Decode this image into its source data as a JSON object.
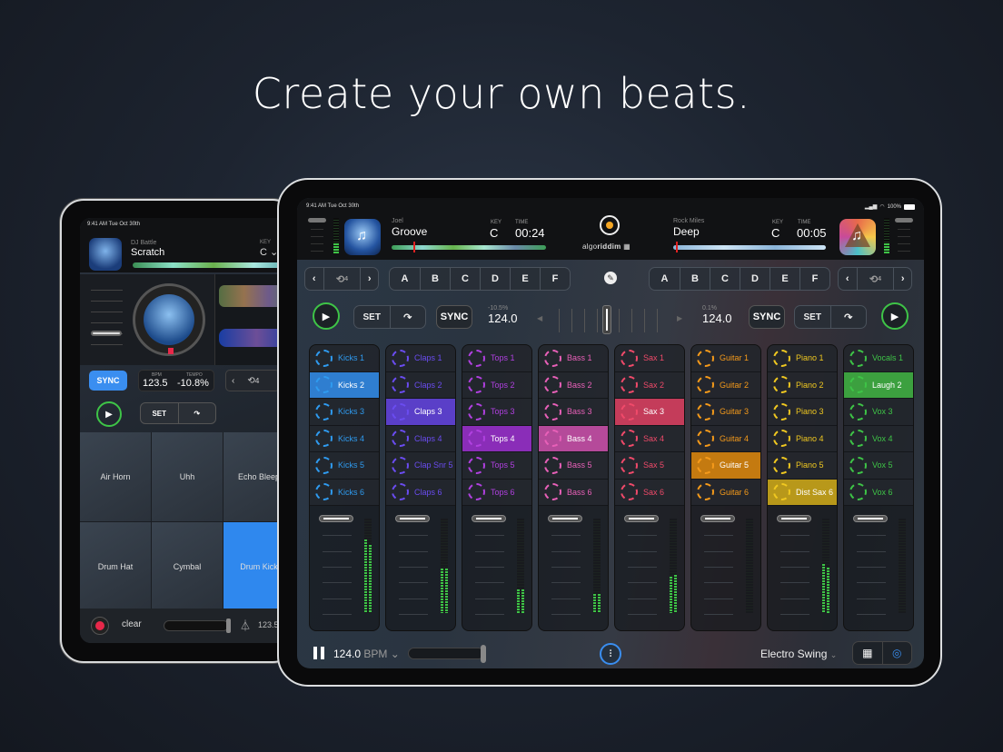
{
  "headline": "Create your own beats.",
  "small_ipad": {
    "status_time": "9:41 AM  Tue Oct 30th",
    "deck": {
      "artist": "DJ Battle",
      "title": "Scratch",
      "key_label": "KEY",
      "key": "C ⌄"
    },
    "sync_label": "SYNC",
    "bpm_label": "BPM",
    "bpm": "123.5",
    "tempo_label": "TEMPO",
    "tempo": "-10.8%",
    "loop_count": "4",
    "set_label": "SET",
    "pads": [
      {
        "label": "Air Horn",
        "active": false
      },
      {
        "label": "Uhh",
        "active": false
      },
      {
        "label": "Echo Bleep",
        "active": false
      },
      {
        "label": "Drum Hat",
        "active": false
      },
      {
        "label": "Cymbal",
        "active": false
      },
      {
        "label": "Drum Kick",
        "active": true
      }
    ],
    "clear_label": "clear",
    "footer_bpm": "123.5"
  },
  "large_ipad": {
    "status_time": "9:41 AM  Tue Oct 30th",
    "status_battery": "100%",
    "brand": {
      "prefix": "algo",
      "suffix": "riddim"
    },
    "deck_left": {
      "artist": "Joel",
      "title": "Groove",
      "key_label": "KEY",
      "key": "C",
      "time_label": "TIME",
      "time": "00:24",
      "pitch": "-10.5%",
      "bpm": "124.0",
      "loop_count": "4"
    },
    "deck_right": {
      "artist": "Rock Miles",
      "title": "Deep",
      "key_label": "KEY",
      "key": "C",
      "time_label": "TIME",
      "time": "00:05",
      "pitch": "0.1%",
      "bpm": "124.0",
      "loop_count": "4"
    },
    "cue_points": [
      "A",
      "B",
      "C",
      "D",
      "E",
      "F"
    ],
    "set_label": "SET",
    "sync_label": "SYNC",
    "crossfader_position": 0.5,
    "columns": [
      {
        "color": "#2f9bf0",
        "active_bg": "#2f7ed0",
        "pads": [
          "Kicks 1",
          "Kicks 2",
          "Kicks 3",
          "Kicks 4",
          "Kicks 5",
          "Kicks 6"
        ],
        "active": 1,
        "level": [
          0.78,
          0.72
        ]
      },
      {
        "color": "#6a4cf0",
        "active_bg": "#5a3fc8",
        "pads": [
          "Claps 1",
          "Claps 2",
          "Claps 3",
          "Claps 4",
          "Clap Snr 5",
          "Claps 6"
        ],
        "active": 2,
        "level": [
          0.47,
          0.47
        ]
      },
      {
        "color": "#b040e0",
        "active_bg": "#8a2db8",
        "pads": [
          "Tops 1",
          "Tops 2",
          "Tops 3",
          "Tops 4",
          "Tops 5",
          "Tops 6"
        ],
        "active": 3,
        "level": [
          0.25,
          0.25
        ]
      },
      {
        "color": "#e860b8",
        "active_bg": "#b54a9a",
        "pads": [
          "Bass 1",
          "Bass 2",
          "Bass 3",
          "Bass 4",
          "Bass 5",
          "Bass 6"
        ],
        "active": 3,
        "level": [
          0.2,
          0.2
        ]
      },
      {
        "color": "#f04a6a",
        "active_bg": "#c43c5a",
        "pads": [
          "Sax 1",
          "Sax 2",
          "Sax 3",
          "Sax 4",
          "Sax 5",
          "Sax 6"
        ],
        "active": 2,
        "level": [
          0.38,
          0.4
        ]
      },
      {
        "color": "#f59a1a",
        "active_bg": "#c47a10",
        "pads": [
          "Guitar 1",
          "Guitar 2",
          "Guitar 3",
          "Guitar 4",
          "Guitar 5",
          "Guitar 6"
        ],
        "active": 4,
        "level": [
          0,
          0
        ]
      },
      {
        "color": "#f0c820",
        "active_bg": "#b8981a",
        "pads": [
          "Piano 1",
          "Piano 2",
          "Piano 3",
          "Piano 4",
          "Piano 5",
          "Dist Sax 6"
        ],
        "active": 5,
        "level": [
          0.52,
          0.48
        ]
      },
      {
        "color": "#3ec447",
        "active_bg": "#3ca03f",
        "pads": [
          "Vocals 1",
          "Laugh 2",
          "Vox 3",
          "Vox 4",
          "Vox 5",
          "Vox 6"
        ],
        "active": 1,
        "level": [
          0,
          0
        ]
      }
    ],
    "footer": {
      "bpm": "124.0",
      "bpm_unit": "BPM ⌄",
      "genre": "Electro Swing",
      "genre_caret": "⌄"
    }
  }
}
